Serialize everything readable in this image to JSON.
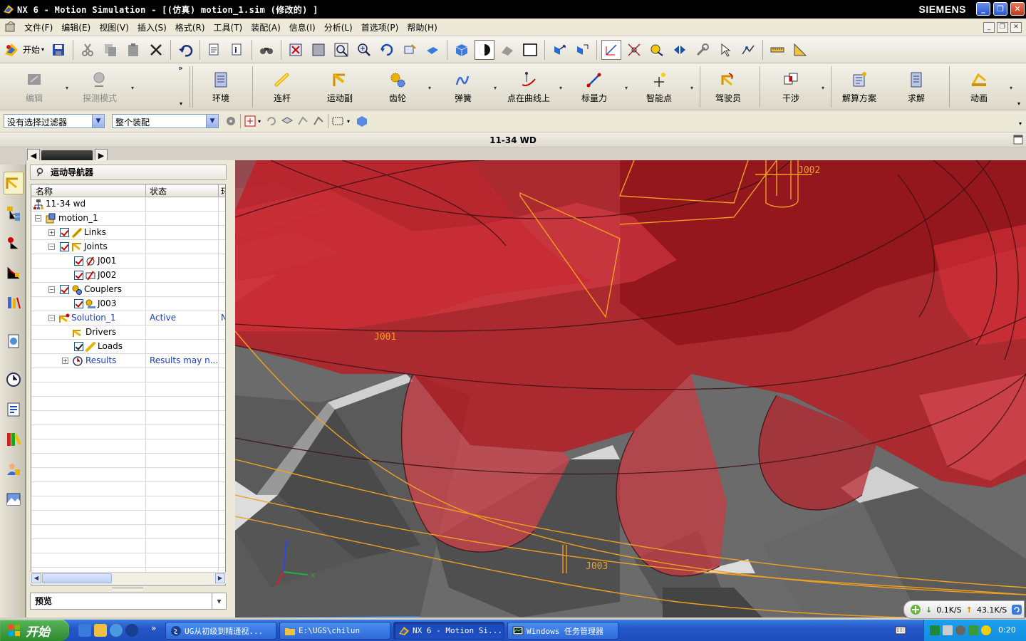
{
  "titlebar": {
    "title": "NX 6 - Motion Simulation - [(仿真) motion_1.sim (修改的) ]",
    "brand": "SIEMENS"
  },
  "menu": {
    "items": [
      "文件(F)",
      "编辑(E)",
      "视图(V)",
      "插入(S)",
      "格式(R)",
      "工具(T)",
      "装配(A)",
      "信息(I)",
      "分析(L)",
      "首选项(P)",
      "帮助(H)"
    ]
  },
  "toolbar": {
    "start_label": "开始"
  },
  "motion_toolbar": {
    "items": [
      {
        "label": "编辑",
        "icon": "edit-icon",
        "disabled": true
      },
      {
        "label": "探测模式",
        "icon": "probe-icon",
        "disabled": true
      },
      {
        "label": "环境",
        "icon": "environment-icon"
      },
      {
        "label": "连杆",
        "icon": "link-icon"
      },
      {
        "label": "运动副",
        "icon": "joint-icon"
      },
      {
        "label": "齿轮",
        "icon": "gear-icon"
      },
      {
        "label": "弹簧",
        "icon": "spring-icon"
      },
      {
        "label": "点在曲线上",
        "icon": "point-on-curve-icon"
      },
      {
        "label": "标量力",
        "icon": "scalar-force-icon"
      },
      {
        "label": "智能点",
        "icon": "smart-point-icon"
      },
      {
        "label": "驾驶员",
        "icon": "driver-icon"
      },
      {
        "label": "干涉",
        "icon": "interference-icon"
      },
      {
        "label": "解算方案",
        "icon": "solution-icon"
      },
      {
        "label": "求解",
        "icon": "solve-icon"
      },
      {
        "label": "动画",
        "icon": "animation-icon"
      }
    ]
  },
  "selection": {
    "filter": "没有选择过滤器",
    "scope": "整个装配"
  },
  "part_name": "11-34 WD",
  "navigator": {
    "title": "运动导航器",
    "columns": {
      "name": "名称",
      "state": "状态",
      "extra": "环"
    },
    "rows": [
      {
        "name": "11-34 wd",
        "state": "",
        "extra": ""
      },
      {
        "name": "motion_1",
        "state": "",
        "extra": ""
      },
      {
        "name": "Links",
        "state": "",
        "extra": ""
      },
      {
        "name": "Joints",
        "state": "",
        "extra": ""
      },
      {
        "name": "J001",
        "state": "",
        "extra": ""
      },
      {
        "name": "J002",
        "state": "",
        "extra": ""
      },
      {
        "name": "Couplers",
        "state": "",
        "extra": ""
      },
      {
        "name": "J003",
        "state": "",
        "extra": ""
      },
      {
        "name": "Solution_1",
        "state": "Active",
        "extra": "N"
      },
      {
        "name": "Drivers",
        "state": "",
        "extra": ""
      },
      {
        "name": "Loads",
        "state": "",
        "extra": ""
      },
      {
        "name": "Results",
        "state": "Results may n...",
        "extra": ""
      }
    ],
    "preview_label": "预览"
  },
  "viewport": {
    "labels": {
      "j001": "J001",
      "j002": "J002",
      "j003": "J003",
      "axis_x": "X",
      "axis_z": "Z"
    },
    "colors": {
      "gear": "#c0141c",
      "rack": "#5e5e5e",
      "curve": "#f0a020"
    }
  },
  "network": {
    "down": "0.1K/S",
    "up": "43.1K/S"
  },
  "taskbar": {
    "start_label": "开始",
    "tasks": [
      {
        "label": "UG从初级到精通视...",
        "active": false
      },
      {
        "label": "E:\\UGS\\chilun",
        "active": false
      },
      {
        "label": "NX 6 - Motion Si...",
        "active": true
      },
      {
        "label": "Windows 任务管理器",
        "active": false
      }
    ],
    "clock": "0:20"
  }
}
